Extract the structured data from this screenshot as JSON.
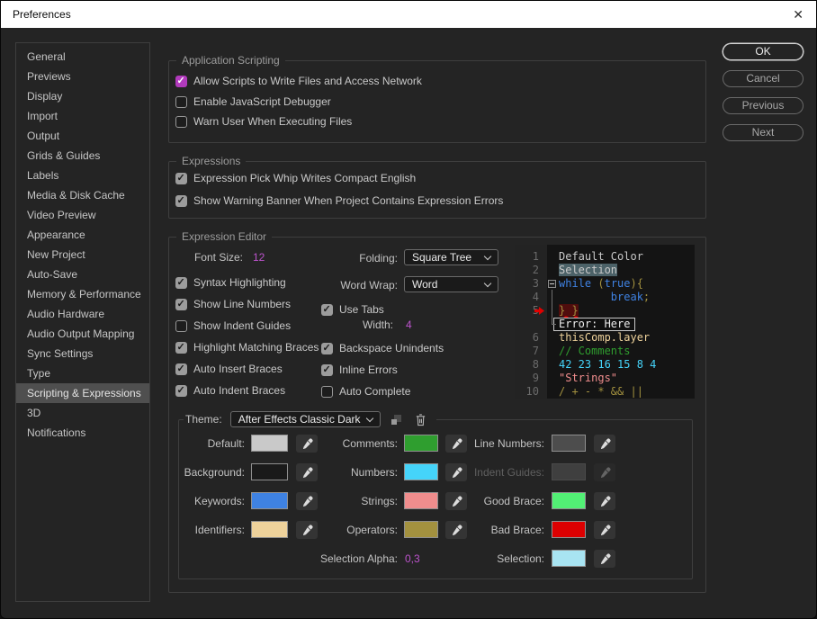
{
  "window": {
    "title": "Preferences",
    "close_glyph": "✕"
  },
  "sidebar": {
    "items": [
      "General",
      "Previews",
      "Display",
      "Import",
      "Output",
      "Grids & Guides",
      "Labels",
      "Media & Disk Cache",
      "Video Preview",
      "Appearance",
      "New Project",
      "Auto-Save",
      "Memory & Performance",
      "Audio Hardware",
      "Audio Output Mapping",
      "Sync Settings",
      "Type",
      "Scripting & Expressions",
      "3D",
      "Notifications"
    ],
    "selected_index": 17
  },
  "action_buttons": [
    {
      "label": "OK",
      "primary": true
    },
    {
      "label": "Cancel",
      "primary": false
    },
    {
      "label": "Previous",
      "primary": false
    },
    {
      "label": "Next",
      "primary": false
    }
  ],
  "colors": {
    "accent": "#b13abc",
    "hot_text": "#bc53cc",
    "selected_row_bg": "#4f4f4f"
  },
  "sections": {
    "application_scripting": {
      "title": "Application Scripting",
      "options": [
        {
          "label": "Allow Scripts to Write Files and Access Network",
          "state": "accent"
        },
        {
          "label": "Enable JavaScript Debugger",
          "state": "off"
        },
        {
          "label": "Warn User When Executing Files",
          "state": "off"
        }
      ]
    },
    "expressions": {
      "title": "Expressions",
      "options": [
        {
          "label": "Expression Pick Whip Writes Compact English",
          "state": "gray"
        },
        {
          "label": "Show Warning Banner When Project Contains Expression Errors",
          "state": "gray"
        }
      ]
    },
    "expression_editor": {
      "title": "Expression Editor",
      "font_size": {
        "label": "Font Size:",
        "value": "12"
      },
      "folding": {
        "label": "Folding:",
        "value": "Square Tree"
      },
      "word_wrap": {
        "label": "Word Wrap:",
        "value": "Word"
      },
      "left_options": [
        {
          "label": "Syntax Highlighting",
          "state": "gray"
        },
        {
          "label": "Show Line Numbers",
          "state": "gray"
        },
        {
          "label": "Show Indent Guides",
          "state": "off"
        },
        {
          "label": "Highlight Matching Braces",
          "state": "gray"
        },
        {
          "label": "Auto Insert Braces",
          "state": "gray"
        },
        {
          "label": "Auto Indent Braces",
          "state": "gray"
        }
      ],
      "middle_options": [
        {
          "label": "Use Tabs",
          "state": "gray"
        },
        {
          "label": "Backspace Unindents",
          "state": "gray"
        },
        {
          "label": "Inline Errors",
          "state": "gray"
        },
        {
          "label": "Auto Complete",
          "state": "off"
        }
      ],
      "tab_width": {
        "label": "Width:",
        "value": "4"
      },
      "preview": {
        "palette": {
          "default": "#c9c9c9",
          "keyword": "#3f82e2",
          "number": "#45d4fa",
          "string": "#f08d8d",
          "comment": "#2f9e2f",
          "operator": "#a3913f",
          "identifier": "#eed29b",
          "line_number": "#6a6a6a"
        },
        "error_label": "Error: Here",
        "lines": [
          {
            "num": "1",
            "segments": [
              {
                "text": "Default Color",
                "color": "default"
              }
            ]
          },
          {
            "num": "2",
            "selected": true,
            "segments": [
              {
                "text": "Selection",
                "color": "default"
              }
            ]
          },
          {
            "num": "3",
            "fold": true,
            "segments": [
              {
                "text": "while ",
                "color": "keyword"
              },
              {
                "text": "(",
                "color": "operator"
              },
              {
                "text": "true",
                "color": "keyword"
              },
              {
                "text": "){",
                "color": "operator"
              }
            ]
          },
          {
            "num": "4",
            "segments": [
              {
                "text": "        ",
                "color": "default"
              },
              {
                "text": "break",
                "color": "keyword"
              },
              {
                "text": ";",
                "color": "operator"
              }
            ]
          },
          {
            "num": "5",
            "marker": true,
            "segments": [
              {
                "text": "} }",
                "color": "operator",
                "bad": true
              }
            ]
          },
          {
            "error": true
          },
          {
            "num": "6",
            "segments": [
              {
                "text": "thisComp.layer",
                "color": "identifier"
              }
            ]
          },
          {
            "num": "7",
            "segments": [
              {
                "text": "// Comments",
                "color": "comment"
              }
            ]
          },
          {
            "num": "8",
            "segments": [
              {
                "text": "42 23 16 15 8 4",
                "color": "number"
              }
            ]
          },
          {
            "num": "9",
            "segments": [
              {
                "text": "\"Strings\"",
                "color": "string"
              }
            ]
          },
          {
            "num": "10",
            "segments": [
              {
                "text": "/ + - * && ||",
                "color": "operator"
              }
            ]
          }
        ]
      },
      "theme": {
        "label": "Theme:",
        "value": "After Effects Classic Dark"
      },
      "color_grid": [
        [
          {
            "label": "Default:",
            "swatch": "#c9c9c9"
          },
          {
            "label": "Comments:",
            "swatch": "#2f9e2f"
          },
          {
            "label": "Line Numbers:",
            "swatch": "#4d4d4d"
          }
        ],
        [
          {
            "label": "Background:",
            "swatch": "#1a1a1a"
          },
          {
            "label": "Numbers:",
            "swatch": "#45d4fa"
          },
          {
            "label": "Indent Guides:",
            "swatch": "#3f3f3f",
            "disabled": true
          }
        ],
        [
          {
            "label": "Keywords:",
            "swatch": "#3f82e2"
          },
          {
            "label": "Strings:",
            "swatch": "#f08d8d"
          },
          {
            "label": "Good Brace:",
            "swatch": "#52f075"
          }
        ],
        [
          {
            "label": "Identifiers:",
            "swatch": "#eed29b"
          },
          {
            "label": "Operators:",
            "swatch": "#a3913f"
          },
          {
            "label": "Bad Brace:",
            "swatch": "#dd0001"
          }
        ],
        [
          null,
          {
            "label": "Selection Alpha:",
            "value": "0,3"
          },
          {
            "label": "Selection:",
            "swatch": "#a8e4f2"
          }
        ]
      ]
    }
  }
}
